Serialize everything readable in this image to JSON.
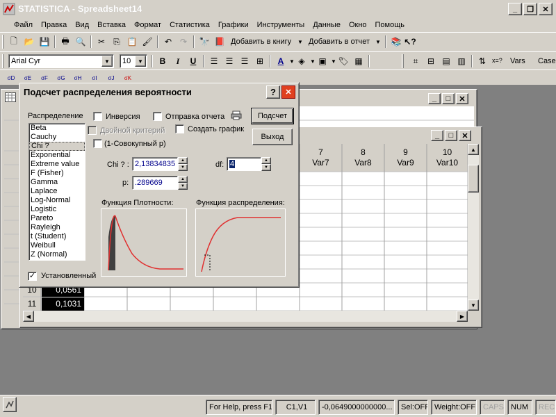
{
  "app": {
    "title": "STATISTICA - Spreadsheet14"
  },
  "menu": [
    "Файл",
    "Правка",
    "Вид",
    "Вставка",
    "Формат",
    "Статистика",
    "Графики",
    "Инструменты",
    "Данные",
    "Окно",
    "Помощь"
  ],
  "toolbar": {
    "add_to_book": "Добавить в книгу",
    "add_to_report": "Добавить в отчет",
    "font": "Arial Cyr",
    "font_size": "10",
    "bold": "B",
    "italic": "I",
    "underline": "U",
    "sum": "x=?",
    "vars": "Vars",
    "case": "Case"
  },
  "spreadsheet": {
    "columns": [
      {
        "num": "7",
        "name": "Var7"
      },
      {
        "num": "8",
        "name": "Var8"
      },
      {
        "num": "9",
        "name": "Var9"
      },
      {
        "num": "10",
        "name": "Var10"
      }
    ],
    "rows": [
      {
        "num": "10",
        "value": "0,0561"
      },
      {
        "num": "11",
        "value": "0,1031"
      }
    ]
  },
  "dialog": {
    "title": "Подсчет распределения вероятности",
    "distribution_label": "Распределение",
    "distributions": [
      "Beta",
      "Cauchy",
      "Chi ?",
      "Exponential",
      "Extreme value",
      "F (Fisher)",
      "Gamma",
      "Laplace",
      "Log-Normal",
      "Logistic",
      "Pareto",
      "Rayleigh",
      "t (Student)",
      "Weibull",
      "Z (Normal)"
    ],
    "selected_distribution": "Chi ?",
    "inversion": "Инверсия",
    "send_report": "Отправка отчета",
    "two_sided": "Двойной критерий",
    "create_graph": "Создать график",
    "cumulative": "(1-Совокупный p)",
    "calc_button": "Подсчет",
    "exit_button": "Выход",
    "chi_label": "Chi ? :",
    "chi_value": "2,13834835",
    "df_label": "df:",
    "df_value": "4",
    "p_label": "p:",
    "p_value": ".289669",
    "density_label": "Функция Плотности:",
    "cdf_label": "Функция распределения:",
    "installed": "Установленный"
  },
  "statusbar": {
    "help": "For Help, press F1",
    "cell": "C1,V1",
    "value": "-0,0649000000000...",
    "sel": "Sel:OFF",
    "weight": "Weight:OFF",
    "caps": "CAPS",
    "num": "NUM",
    "rec": "REC"
  }
}
